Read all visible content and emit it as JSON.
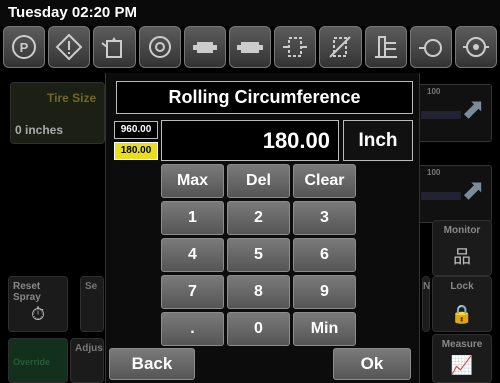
{
  "status": {
    "clock": "Tuesday 02:20 PM"
  },
  "toolbar": {
    "icons": [
      "parking-brake-icon",
      "warning-icon",
      "fluid-level-icon",
      "oil-icon",
      "engine-icon",
      "engine-alt-icon",
      "filter-icon",
      "filter-bypass-icon",
      "hydraulic-icon",
      "pressure-icon",
      "fan-icon"
    ]
  },
  "background": {
    "tire_size_label": "Tire Size",
    "tire_size_value": "0 inches",
    "gauge_scale": "100",
    "reset_spray_label": "Reset Spray",
    "reset_partial": "Se",
    "adjust_partial": "Adjus",
    "monitor_label": "Monitor",
    "lock_label": "Lock",
    "measure_label": "Measure",
    "n_partial": "N",
    "green_tile_label": "Override"
  },
  "dialog": {
    "title": "Rolling Circumference",
    "max_limit": "960.00",
    "min_limit": "180.00",
    "value": "180.00",
    "unit": "Inch",
    "keys": [
      "Max",
      "Del",
      "Clear",
      "1",
      "2",
      "3",
      "4",
      "5",
      "6",
      "7",
      "8",
      "9",
      ".",
      "0",
      "Min"
    ],
    "back_label": "Back",
    "ok_label": "Ok"
  },
  "colors": {
    "min_limit_bg": "#e9df1c",
    "key_bg": "#666666"
  }
}
